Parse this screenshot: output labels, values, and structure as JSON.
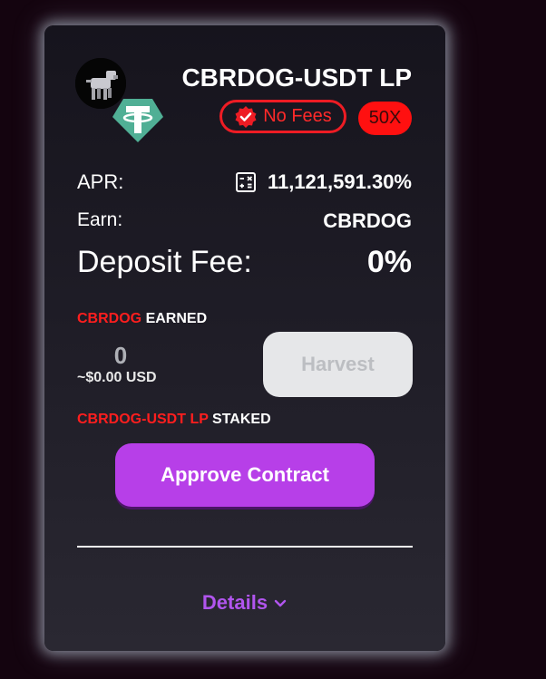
{
  "farm": {
    "title": "CBRDOG-USDT LP",
    "token_logo_icon": "robot-dog-icon",
    "quote_logo_icon": "tether-icon",
    "no_fees_label": "No Fees",
    "no_fees_icon": "verified-check-icon",
    "multiplier": "50X"
  },
  "stats": {
    "apr_label": "APR:",
    "apr_value": "11,121,591.30%",
    "apr_icon": "calculator-icon",
    "earn_label": "Earn:",
    "earn_value": "CBRDOG",
    "deposit_fee_label": "Deposit Fee:",
    "deposit_fee_value": "0%"
  },
  "earned": {
    "token": "CBRDOG",
    "suffix": "EARNED",
    "amount": "0",
    "usd": "~$0.00 USD",
    "harvest_label": "Harvest"
  },
  "staked": {
    "token": "CBRDOG-USDT LP",
    "suffix": "STAKED",
    "approve_label": "Approve Contract"
  },
  "footer": {
    "details_label": "Details",
    "details_icon": "chevron-down-icon"
  },
  "colors": {
    "accent_red": "#ff1e1e",
    "accent_purple": "#b73fe8",
    "tether_green": "#50af95"
  }
}
